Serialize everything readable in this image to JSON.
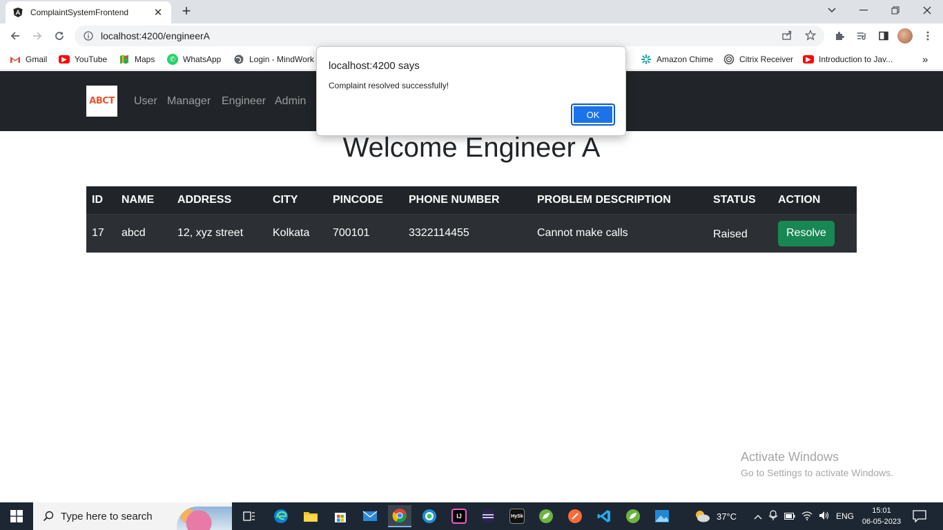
{
  "browser": {
    "tab": {
      "title": "ComplaintSystemFrontend"
    },
    "url": "localhost:4200/engineerA",
    "bookmarks": [
      {
        "label": "Gmail",
        "icon": "gmail-icon",
        "color": "#ea4335"
      },
      {
        "label": "YouTube",
        "icon": "youtube-icon",
        "color": "#ff0000"
      },
      {
        "label": "Maps",
        "icon": "maps-icon",
        "color": "#34a853"
      },
      {
        "label": "WhatsApp",
        "icon": "whatsapp-icon",
        "color": "#25d366"
      },
      {
        "label": "Login - MindWork",
        "icon": "globe-icon",
        "color": "#5f6368"
      },
      {
        "label": "Amazon Chime",
        "icon": "chime-icon",
        "color": "#1aa3a3"
      },
      {
        "label": "Citrix Receiver",
        "icon": "citrix-icon",
        "color": "#555555"
      },
      {
        "label": "Introduction to Jav...",
        "icon": "youtube-icon",
        "color": "#ff0000"
      }
    ],
    "bookmarks_overflow": "»"
  },
  "app": {
    "logo_text_a": "AB",
    "logo_text_b": "CT",
    "nav": [
      "User",
      "Manager",
      "Engineer",
      "Admin"
    ]
  },
  "page": {
    "heading": "Welcome Engineer A",
    "table": {
      "columns": [
        "ID",
        "NAME",
        "ADDRESS",
        "CITY",
        "PINCODE",
        "PHONE NUMBER",
        "PROBLEM DESCRIPTION",
        "STATUS",
        "ACTION"
      ],
      "rows": [
        {
          "id": "17",
          "name": "abcd",
          "address": "12, xyz street",
          "city": "Kolkata",
          "pincode": "700101",
          "phone": "3322114455",
          "problem": "Cannot make calls",
          "status": "Raised",
          "action": "Resolve"
        }
      ]
    }
  },
  "dialog": {
    "title": "localhost:4200 says",
    "message": "Complaint resolved successfully!",
    "ok_label": "OK"
  },
  "watermark": {
    "line1": "Activate Windows",
    "line2": "Go to Settings to activate Windows."
  },
  "taskbar": {
    "search_placeholder": "Type here to search",
    "weather": "37°C",
    "language": "ENG",
    "time": "15:01",
    "date": "06-05-2023"
  },
  "colors": {
    "navbar_bg": "#212529",
    "table_bg": "#212529",
    "resolve_button": "#198754",
    "dialog_ok": "#1a73e8"
  }
}
